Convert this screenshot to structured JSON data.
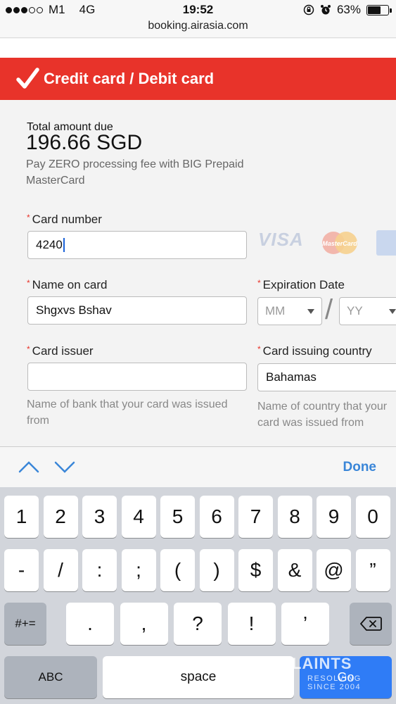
{
  "status": {
    "carrier": "M1",
    "network": "4G",
    "time": "19:52",
    "battery": "63%",
    "battery_level": 0.63
  },
  "browser": {
    "url": "booking.airasia.com"
  },
  "header": {
    "title": "Credit card / Debit card"
  },
  "payment": {
    "amount_label": "Total amount due",
    "amount": "196.66 SGD",
    "promo": "Pay ZERO processing fee with BIG Prepaid MasterCard"
  },
  "form": {
    "card_number_label": "Card number",
    "card_number_value": "4240",
    "card_logos": [
      "VISA",
      "MasterCard",
      "American Express"
    ],
    "name_label": "Name on card",
    "name_value": "Shgxvs Bshav",
    "expiry_label": "Expiration Date",
    "month_placeholder": "MM",
    "year_placeholder": "YY",
    "expiry_separator": "/",
    "issuer_label": "Card issuer",
    "issuer_value": "",
    "issuer_help": "Name of bank that your card was issued from",
    "country_label": "Card issuing country",
    "country_value": "Bahamas",
    "country_help": "Name of country that your card was issued from",
    "required_mark": "*"
  },
  "toolbar": {
    "done_label": "Done"
  },
  "keyboard": {
    "row1": [
      "1",
      "2",
      "3",
      "4",
      "5",
      "6",
      "7",
      "8",
      "9",
      "0"
    ],
    "row2": [
      "-",
      "/",
      ":",
      ";",
      "(",
      ")",
      "$",
      "&",
      "@",
      "”"
    ],
    "row3": [
      ".",
      ",",
      "?",
      "!",
      "’"
    ],
    "symbols_key": "#+=",
    "abc_key": "ABC",
    "space_key": "space",
    "go_key": "Go"
  },
  "watermark": {
    "line1": "LAINTS",
    "line2": "RESOLVING",
    "line3": "SINCE 2004"
  }
}
